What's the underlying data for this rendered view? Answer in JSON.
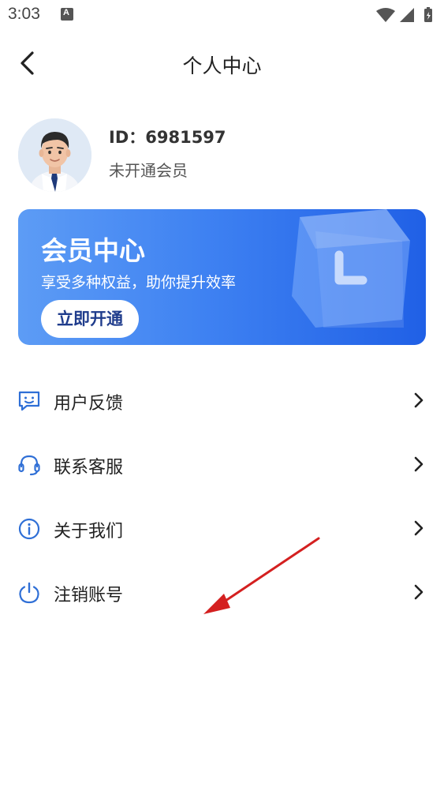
{
  "status_bar": {
    "time": "3:03",
    "notification_letter": "A"
  },
  "nav": {
    "title": "个人中心"
  },
  "profile": {
    "id_text": "ID：6981597",
    "member_status": "未开通会员"
  },
  "banner": {
    "title": "会员中心",
    "subtitle": "享受多种权益，助你提升效率",
    "button_label": "立即开通",
    "accent_color": "#3f82f2"
  },
  "menu": {
    "items": [
      {
        "label": "用户反馈",
        "icon": "feedback-icon"
      },
      {
        "label": "联系客服",
        "icon": "headset-icon"
      },
      {
        "label": "关于我们",
        "icon": "info-icon"
      },
      {
        "label": "注销账号",
        "icon": "power-icon"
      }
    ]
  },
  "colors": {
    "icon_blue": "#2f6fd6",
    "annotation_red": "#d42020"
  }
}
